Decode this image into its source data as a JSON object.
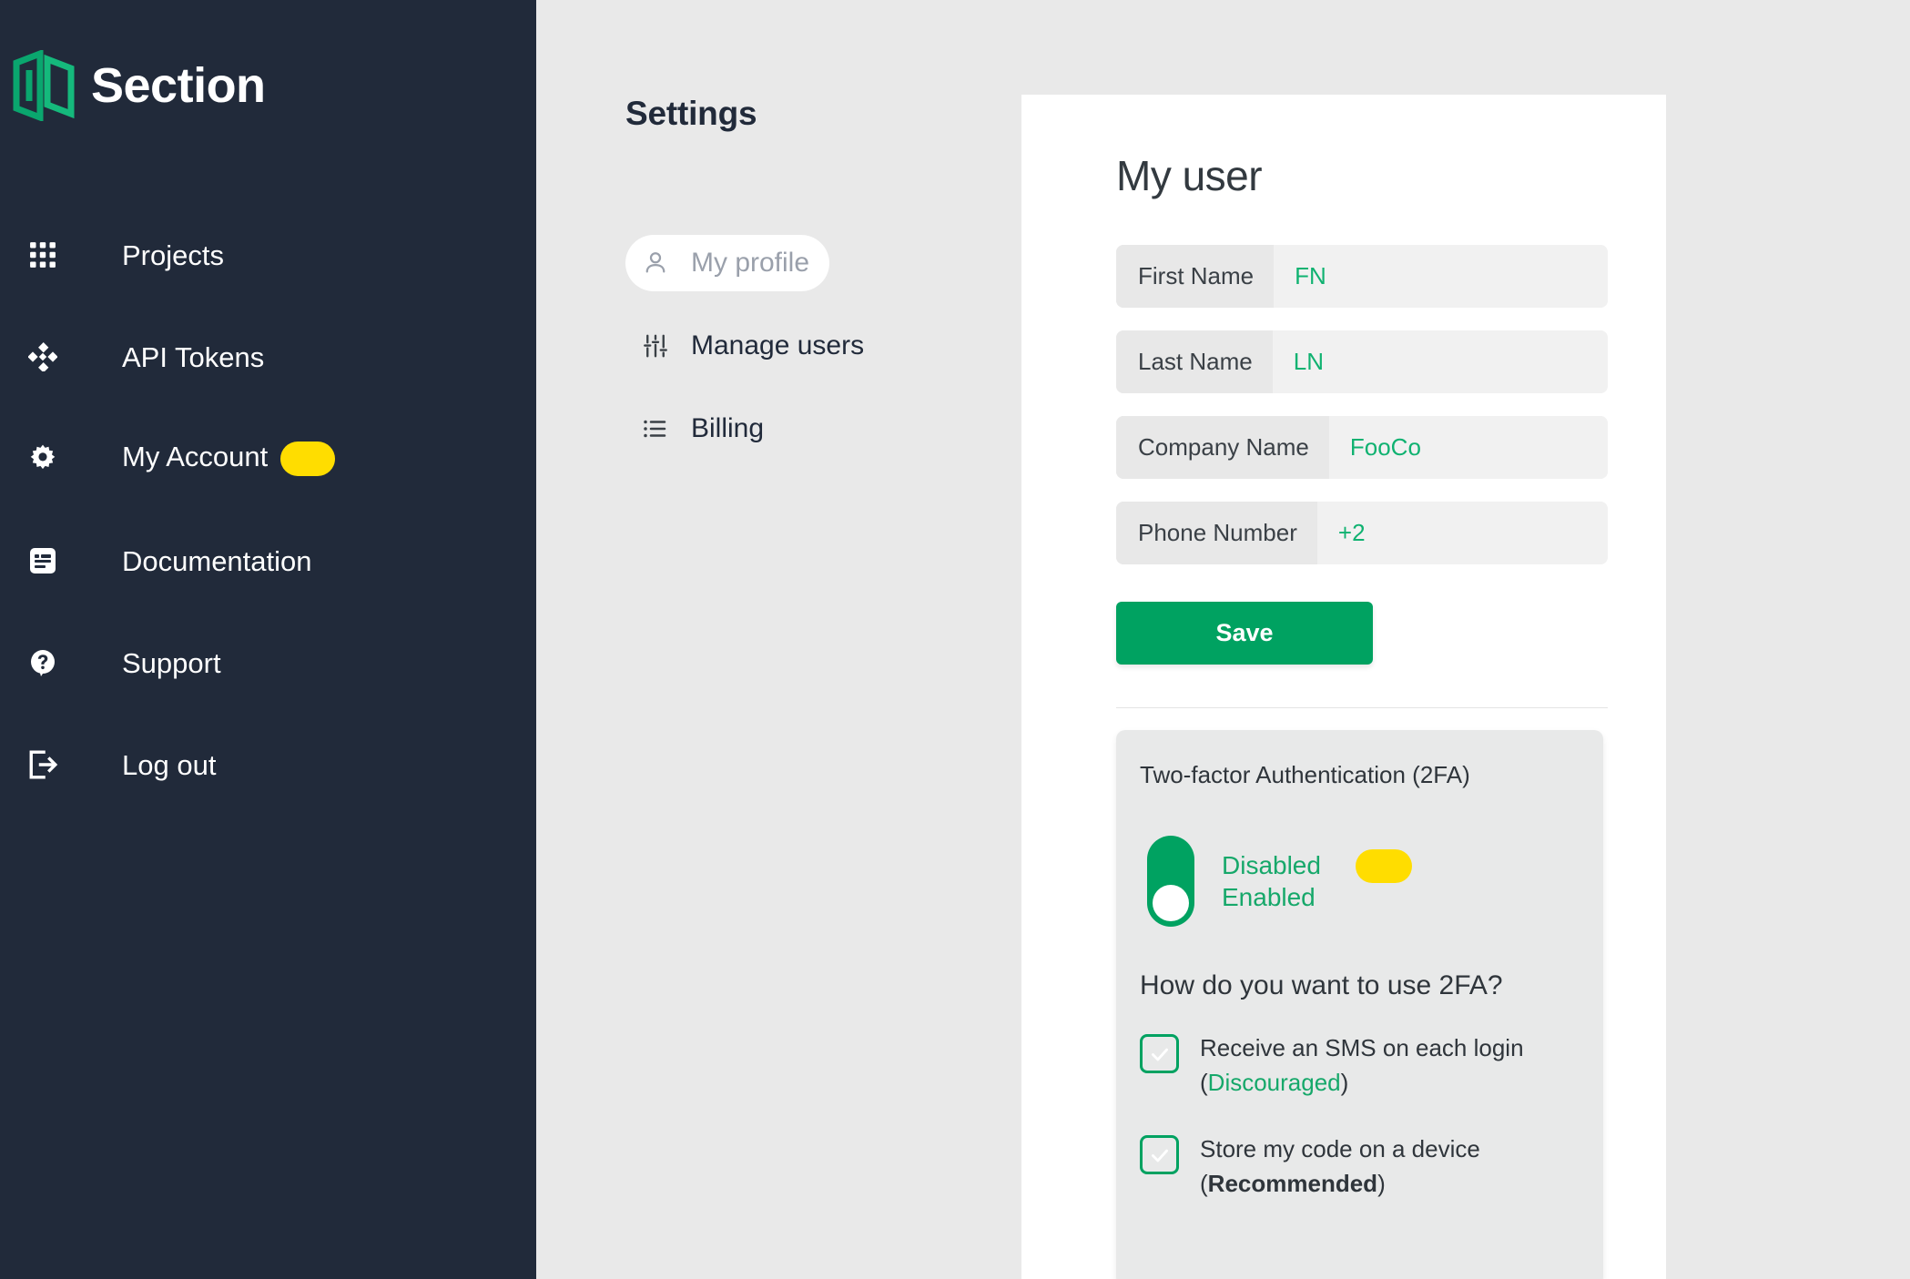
{
  "brand": {
    "name": "Section",
    "logo_icon": "section-logo-icon",
    "logo_color": "#0aa66e"
  },
  "sidebar": {
    "items": [
      {
        "label": "Projects",
        "icon": "grid-icon",
        "badge": null
      },
      {
        "label": "API Tokens",
        "icon": "diamond-cluster-icon",
        "badge": null
      },
      {
        "label": "My Account",
        "icon": "gear-icon",
        "badge": "yellow-pill-highlight"
      },
      {
        "label": "Documentation",
        "icon": "document-icon",
        "badge": null
      },
      {
        "label": "Support",
        "icon": "question-bubble-icon",
        "badge": null
      },
      {
        "label": "Log out",
        "icon": "logout-icon",
        "badge": null
      }
    ]
  },
  "settings": {
    "title": "Settings",
    "nav": [
      {
        "label": "My profile",
        "icon": "person-icon",
        "active": true
      },
      {
        "label": "Manage users",
        "icon": "sliders-icon",
        "active": false
      },
      {
        "label": "Billing",
        "icon": "list-icon",
        "active": false
      }
    ]
  },
  "profile": {
    "title": "My user",
    "fields": [
      {
        "label": "First Name",
        "value": "FN"
      },
      {
        "label": "Last Name",
        "value": "LN"
      },
      {
        "label": "Company Name",
        "value": "FooCo"
      },
      {
        "label": "Phone Number",
        "value": "+2"
      }
    ],
    "save_label": "Save"
  },
  "two_factor": {
    "title": "Two-factor Authentication (2FA)",
    "toggle": {
      "state_off_label": "Disabled",
      "state_on_label": "Enabled",
      "current": "Disabled",
      "badge": "yellow-pill-highlight"
    },
    "question": "How do you want to use 2FA?",
    "options": [
      {
        "label": "Receive an SMS on each login",
        "note_open": "(",
        "note": "Discouraged",
        "note_close": ")",
        "note_style": "green",
        "checked": true
      },
      {
        "label": "Store my code on a device",
        "note_open": "(",
        "note": "Recommended",
        "note_close": ")",
        "note_style": "bold",
        "checked": true
      }
    ]
  },
  "colors": {
    "sidebar_bg": "#212a3a",
    "page_bg": "#e9e9e9",
    "brand_green": "#0aa66e",
    "accent_green": "#00a261",
    "highlight_yellow": "#ffdd00",
    "card_bg": "#ffffff"
  }
}
